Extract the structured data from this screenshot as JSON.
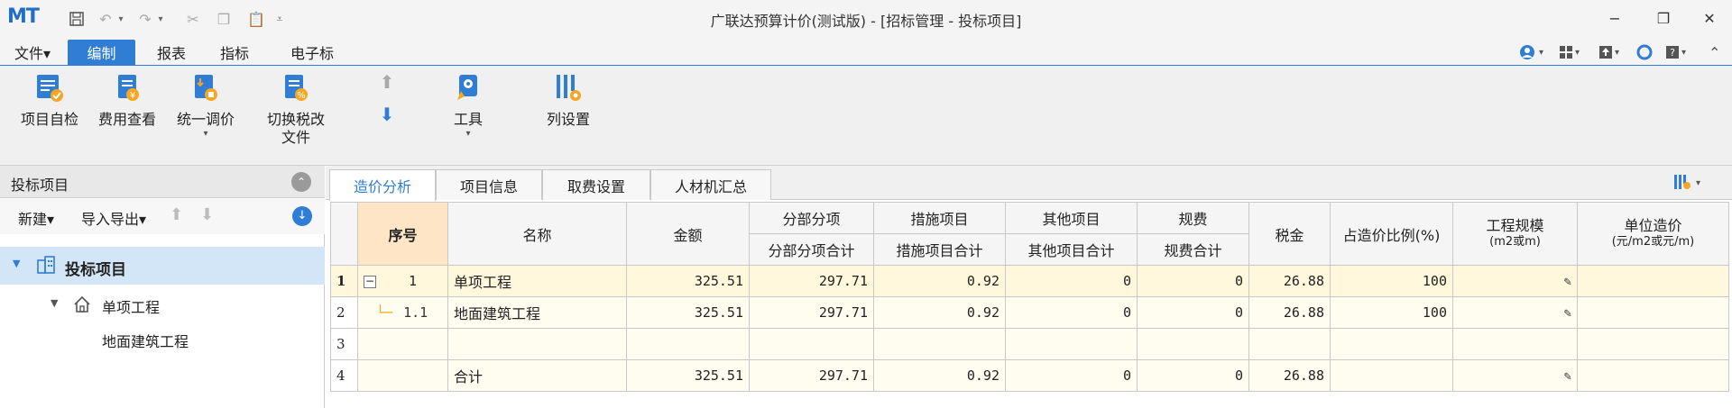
{
  "app": {
    "logo": "MT",
    "title": "广联达预算计价(测试版) - [招标管理 - 投标项目]"
  },
  "menu": {
    "file": "文件▾",
    "tabs": [
      "编制",
      "报表",
      "指标",
      "电子标"
    ]
  },
  "ribbon": {
    "self_check": "项目自检",
    "fee_view": "费用查看",
    "unified_adjust": "统一调价",
    "switch_tax_1": "切换税改",
    "switch_tax_2": "文件",
    "tools": "工具",
    "columns": "列设置"
  },
  "left_pane": {
    "title": "投标项目",
    "new": "新建▾",
    "import_export": "导入导出▾",
    "tree": [
      {
        "label": "投标项目"
      },
      {
        "label": "单项工程"
      },
      {
        "label": "地面建筑工程"
      }
    ]
  },
  "content_tabs": [
    "造价分析",
    "项目信息",
    "取费设置",
    "人材机汇总"
  ],
  "grid": {
    "headers": {
      "seq": "序号",
      "name": "名称",
      "amount": "金额",
      "sub_items": "分部分项",
      "sub_items_total": "分部分项合计",
      "measures": "措施项目",
      "measures_total": "措施项目合计",
      "others": "其他项目",
      "others_total": "其他项目合计",
      "fees": "规费",
      "fees_total": "规费合计",
      "tax": "税金",
      "ratio": "占造价比例(%)",
      "scale_1": "工程规模",
      "scale_2": "(m2或m)",
      "unit_cost_1": "单位造价",
      "unit_cost_2": "(元/m2或元/m)"
    },
    "rows": [
      {
        "rn": "1",
        "seq": "1",
        "name": "单项工程",
        "amount": "325.51",
        "sub": "297.71",
        "meas": "0.92",
        "other": "0",
        "fee": "0",
        "tax": "26.88",
        "ratio": "100"
      },
      {
        "rn": "2",
        "seq": "1.1",
        "name": "地面建筑工程",
        "amount": "325.51",
        "sub": "297.71",
        "meas": "0.92",
        "other": "0",
        "fee": "0",
        "tax": "26.88",
        "ratio": "100"
      },
      {
        "rn": "3",
        "seq": "",
        "name": "",
        "amount": "",
        "sub": "",
        "meas": "",
        "other": "",
        "fee": "",
        "tax": "",
        "ratio": ""
      },
      {
        "rn": "4",
        "seq": "",
        "name": "合计",
        "amount": "325.51",
        "sub": "297.71",
        "meas": "0.92",
        "other": "0",
        "fee": "0",
        "tax": "26.88",
        "ratio": ""
      }
    ]
  },
  "colors": {
    "accent": "#2f7dd5",
    "seq_header": "#fde5c5",
    "selection": "#d3e6f7"
  }
}
